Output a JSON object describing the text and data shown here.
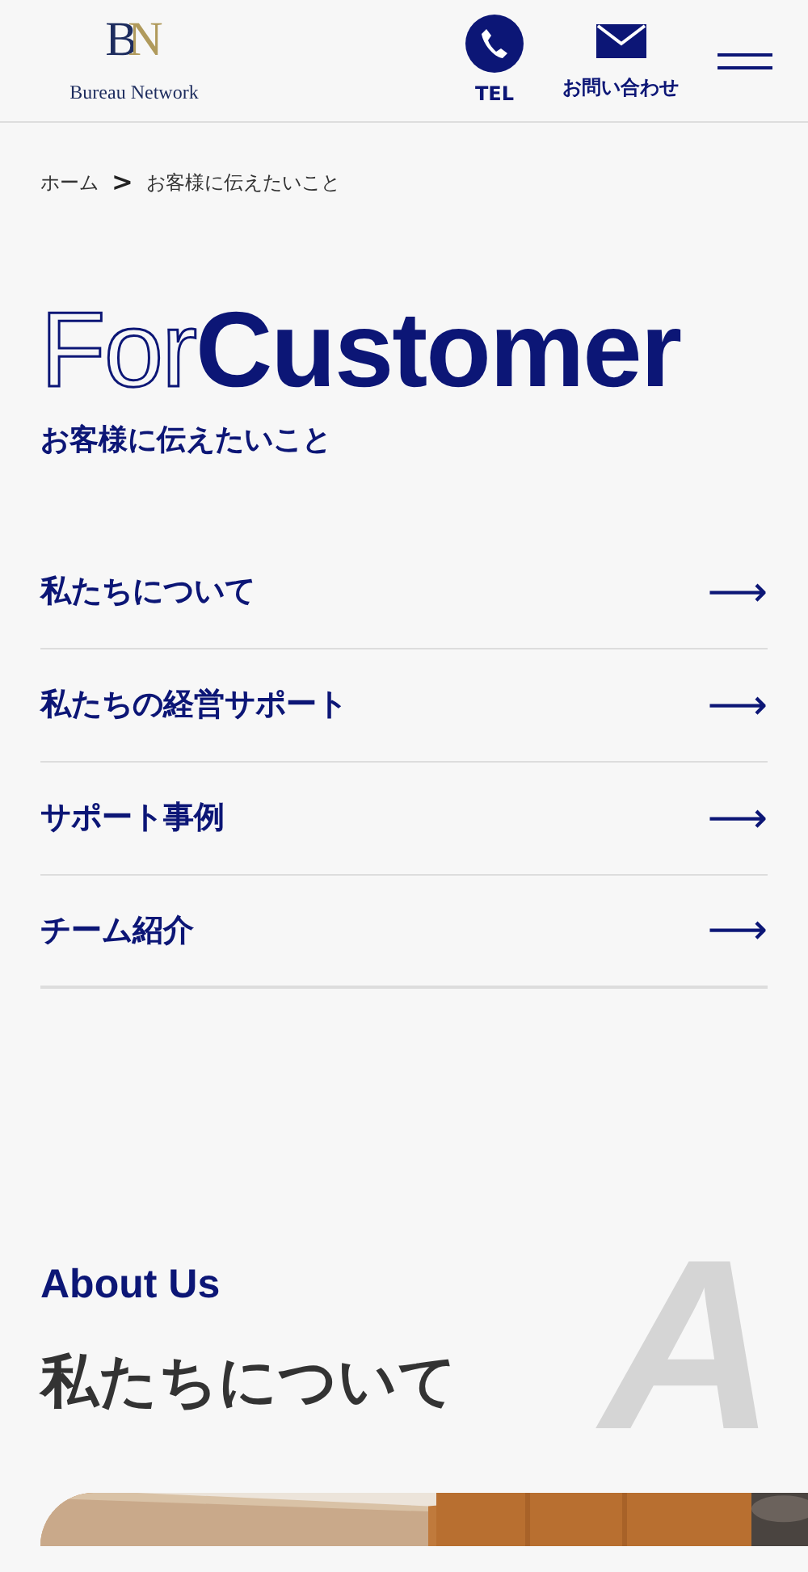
{
  "header": {
    "logo": {
      "mark": [
        "B",
        "N"
      ],
      "name": "Bureau Network"
    },
    "tel": {
      "label": "TEL"
    },
    "contact": {
      "label": "お問い合わせ"
    }
  },
  "breadcrumb": {
    "items": [
      "ホーム",
      "お客様に伝えたいこと"
    ],
    "separator": ">"
  },
  "hero": {
    "title_outline": "For",
    "title_solid": "Customer",
    "subtitle": "お客様に伝えたいこと"
  },
  "menu": [
    {
      "label": "私たちについて",
      "arrow": "⟶"
    },
    {
      "label": "私たちの経営サポート",
      "arrow": "⟶"
    },
    {
      "label": "サポート事例",
      "arrow": "⟶"
    },
    {
      "label": "チーム紹介",
      "arrow": "⟶"
    }
  ],
  "about": {
    "eyebrow": "About Us",
    "heading": "私たちについて",
    "deco_letter": "A"
  }
}
